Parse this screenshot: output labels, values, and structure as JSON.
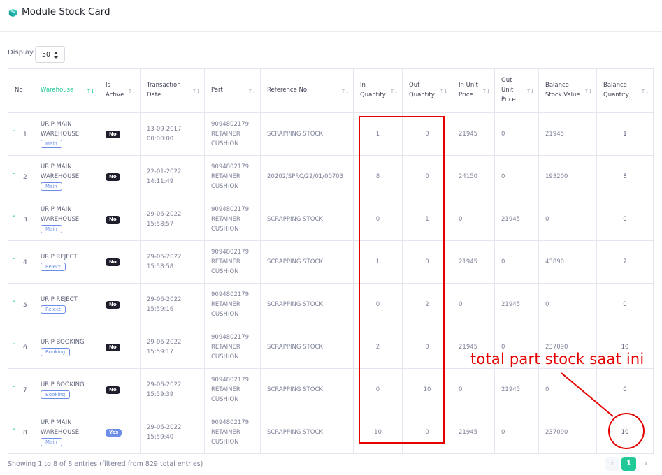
{
  "page": {
    "title": "Module Stock Card"
  },
  "display": {
    "label": "Display",
    "value": "50"
  },
  "table": {
    "headers": {
      "no": "No",
      "warehouse": "Warehouse",
      "is_active": "Is Active",
      "transaction_date": "Transaction Date",
      "part": "Part",
      "reference_no": "Reference No",
      "in_quantity": "In Quantity",
      "out_quantity": "Out Quantity",
      "in_unit_price": "In Unit Price",
      "out_unit_price": "Out Unit Price",
      "balance_stock_value": "Balance Stock Value",
      "balance_quantity": "Balance Quantity"
    },
    "rows": [
      {
        "no": "1",
        "warehouse": "URIP MAIN WAREHOUSE",
        "tag": "Main",
        "active": "No",
        "date": "13-09-2017",
        "time": "00:00:00",
        "part_no": "9094802179",
        "part_name": "RETAINER CUSHION",
        "ref": "SCRAPPING STOCK",
        "in_qty": "1",
        "out_qty": "0",
        "in_price": "21945",
        "out_price": "0",
        "bal_value": "21945",
        "bal_qty": "1"
      },
      {
        "no": "2",
        "warehouse": "URIP MAIN WAREHOUSE",
        "tag": "Main",
        "active": "No",
        "date": "22-01-2022",
        "time": "14:11:49",
        "part_no": "9094802179",
        "part_name": "RETAINER CUSHION",
        "ref": "20202/SPRC/22/01/00703",
        "in_qty": "8",
        "out_qty": "0",
        "in_price": "24150",
        "out_price": "0",
        "bal_value": "193200",
        "bal_qty": "8"
      },
      {
        "no": "3",
        "warehouse": "URIP MAIN WAREHOUSE",
        "tag": "Main",
        "active": "No",
        "date": "29-06-2022",
        "time": "15:58:57",
        "part_no": "9094802179",
        "part_name": "RETAINER CUSHION",
        "ref": "SCRAPPING STOCK",
        "in_qty": "0",
        "out_qty": "1",
        "in_price": "0",
        "out_price": "21945",
        "bal_value": "0",
        "bal_qty": "0"
      },
      {
        "no": "4",
        "warehouse": "URIP REJECT",
        "tag": "Reject",
        "active": "No",
        "date": "29-06-2022",
        "time": "15:58:58",
        "part_no": "9094802179",
        "part_name": "RETAINER CUSHION",
        "ref": "SCRAPPING STOCK",
        "in_qty": "1",
        "out_qty": "0",
        "in_price": "21945",
        "out_price": "0",
        "bal_value": "43890",
        "bal_qty": "2"
      },
      {
        "no": "5",
        "warehouse": "URIP REJECT",
        "tag": "Reject",
        "active": "No",
        "date": "29-06-2022",
        "time": "15:59:16",
        "part_no": "9094802179",
        "part_name": "RETAINER CUSHION",
        "ref": "SCRAPPING STOCK",
        "in_qty": "0",
        "out_qty": "2",
        "in_price": "0",
        "out_price": "21945",
        "bal_value": "0",
        "bal_qty": "0"
      },
      {
        "no": "6",
        "warehouse": "URIP BOOKING",
        "tag": "Booking",
        "active": "No",
        "date": "29-06-2022",
        "time": "15:59:17",
        "part_no": "9094802179",
        "part_name": "RETAINER CUSHION",
        "ref": "SCRAPPING STOCK",
        "in_qty": "2",
        "out_qty": "0",
        "in_price": "21945",
        "out_price": "0",
        "bal_value": "237090",
        "bal_qty": "10"
      },
      {
        "no": "7",
        "warehouse": "URIP BOOKING",
        "tag": "Booking",
        "active": "No",
        "date": "29-06-2022",
        "time": "15:59:39",
        "part_no": "9094802179",
        "part_name": "RETAINER CUSHION",
        "ref": "SCRAPPING STOCK",
        "in_qty": "0",
        "out_qty": "10",
        "in_price": "0",
        "out_price": "21945",
        "bal_value": "0",
        "bal_qty": "0"
      },
      {
        "no": "8",
        "warehouse": "URIP MAIN WAREHOUSE",
        "tag": "Main",
        "active": "Yes",
        "date": "29-06-2022",
        "time": "15:59:40",
        "part_no": "9094802179",
        "part_name": "RETAINER CUSHION",
        "ref": "SCRAPPING STOCK",
        "in_qty": "10",
        "out_qty": "0",
        "in_price": "21945",
        "out_price": "0",
        "bal_value": "237090",
        "bal_qty": "10"
      }
    ]
  },
  "footer": {
    "info": "Showing 1 to 8 of 8 entries (filtered from 829 total entries)",
    "current_page": "1",
    "prev": "‹",
    "next": "›"
  },
  "annotation": {
    "text": "total part stock saat ini"
  },
  "colors": {
    "accent": "#20c997",
    "annotation": "#e60000",
    "badge": "#6c8ee8"
  },
  "icons": {
    "title": "cube-icon",
    "expand": "chevron-down-icon",
    "sort": "sort-arrows-icon"
  }
}
